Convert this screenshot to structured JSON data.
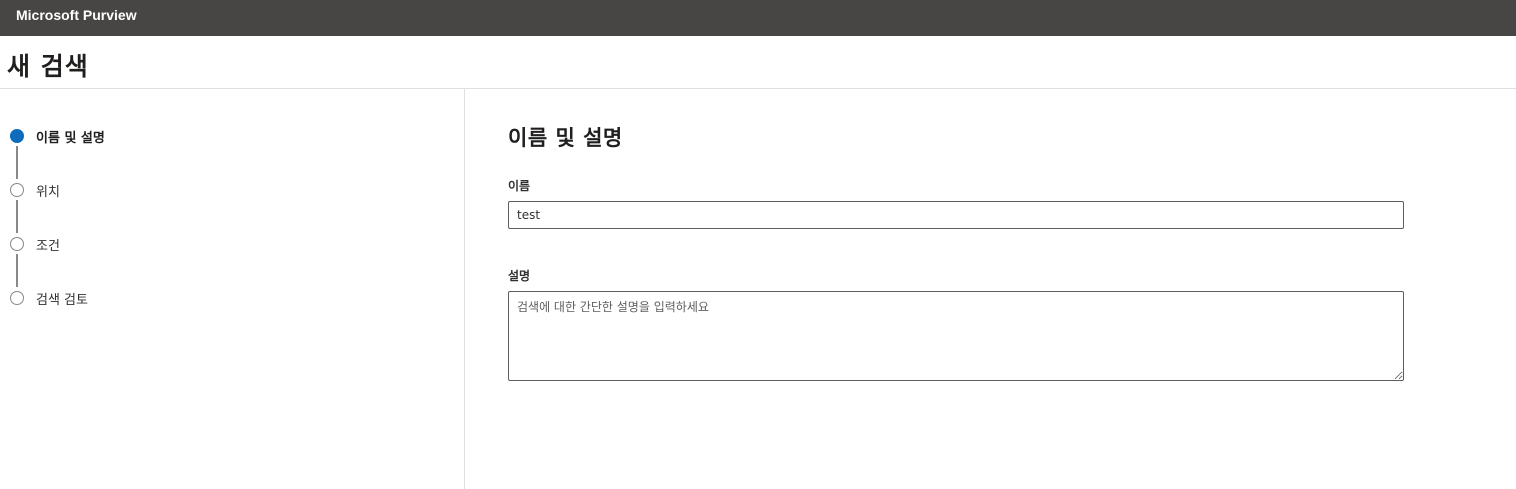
{
  "app": {
    "title": "Microsoft Purview"
  },
  "page": {
    "title": "새 검색"
  },
  "steps": [
    {
      "label": "이름 및 설명",
      "state": "active"
    },
    {
      "label": "위치",
      "state": "pending"
    },
    {
      "label": "조건",
      "state": "pending"
    },
    {
      "label": "검색 검토",
      "state": "pending"
    }
  ],
  "form": {
    "section_title": "이름 및 설명",
    "name": {
      "label": "이름",
      "value": "test"
    },
    "description": {
      "label": "설명",
      "placeholder": "검색에 대한 간단한 설명을 입력하세요",
      "value": ""
    }
  },
  "colors": {
    "topbar": "#484644",
    "accent": "#0f6cbd",
    "border": "#e1dfdd"
  }
}
